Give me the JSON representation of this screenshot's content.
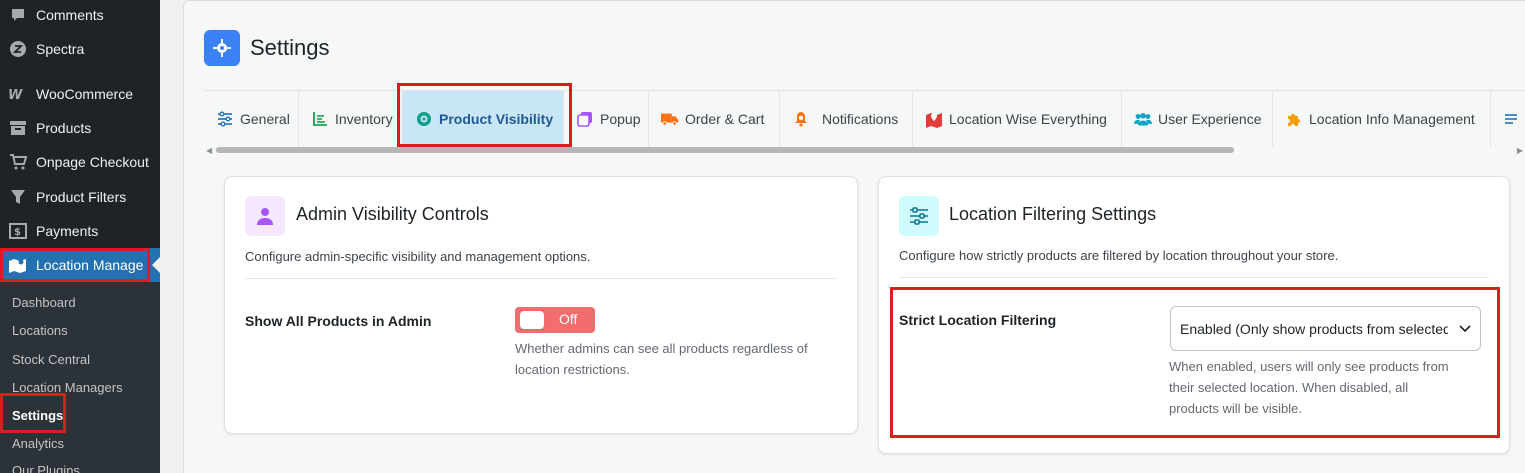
{
  "sidebar": {
    "items": [
      {
        "label": "Comments",
        "icon": "comment-icon"
      },
      {
        "label": "Spectra",
        "icon": "spectra-icon"
      },
      {
        "label": "WooCommerce",
        "icon": "woocommerce-icon"
      },
      {
        "label": "Products",
        "icon": "archive-icon"
      },
      {
        "label": "Onpage Checkout",
        "icon": "cart-icon"
      },
      {
        "label": "Product Filters",
        "icon": "filter-icon"
      },
      {
        "label": "Payments",
        "icon": "payments-icon"
      },
      {
        "label": "Location Manage",
        "icon": "map-icon"
      }
    ],
    "submenu": [
      "Dashboard",
      "Locations",
      "Stock Central",
      "Location Managers",
      "Settings",
      "Analytics",
      "Our Plugins"
    ]
  },
  "page": {
    "title": "Settings"
  },
  "tabs": [
    {
      "label": "General",
      "icon": "sliders-icon"
    },
    {
      "label": "Inventory",
      "icon": "chart-icon"
    },
    {
      "label": "Product Visibility",
      "icon": "eye-icon"
    },
    {
      "label": "Popup",
      "icon": "popup-icon"
    },
    {
      "label": "Order & Cart",
      "icon": "truck-icon"
    },
    {
      "label": "Notifications",
      "icon": "bell-icon"
    },
    {
      "label": "Location Wise Everything",
      "icon": "map-marker-icon"
    },
    {
      "label": "User Experience",
      "icon": "users-icon"
    },
    {
      "label": "Location Info Management",
      "icon": "puzzle-icon"
    }
  ],
  "admin_card": {
    "title": "Admin Visibility Controls",
    "description": "Configure admin-specific visibility and management options.",
    "field_label": "Show All Products in Admin",
    "toggle_label": "Off",
    "help_line1": "Whether admins can see all products regardless of",
    "help_line2": "location restrictions."
  },
  "filter_card": {
    "title": "Location Filtering Settings",
    "description": "Configure how strictly products are filtered by location throughout your store.",
    "field_label": "Strict Location Filtering",
    "select_value": "Enabled (Only show products from selected location)",
    "help_line1": "When enabled, users will only see products from",
    "help_line2": "their selected location. When disabled, all",
    "help_line3": "products will be visible."
  },
  "colors": {
    "sidebar_bg": "#1d2327",
    "active_menu": "#2271b1",
    "active_tab_bg": "#c9e6f7",
    "toggle_off": "#f26d6d",
    "highlight_red": "#d81e1e"
  }
}
